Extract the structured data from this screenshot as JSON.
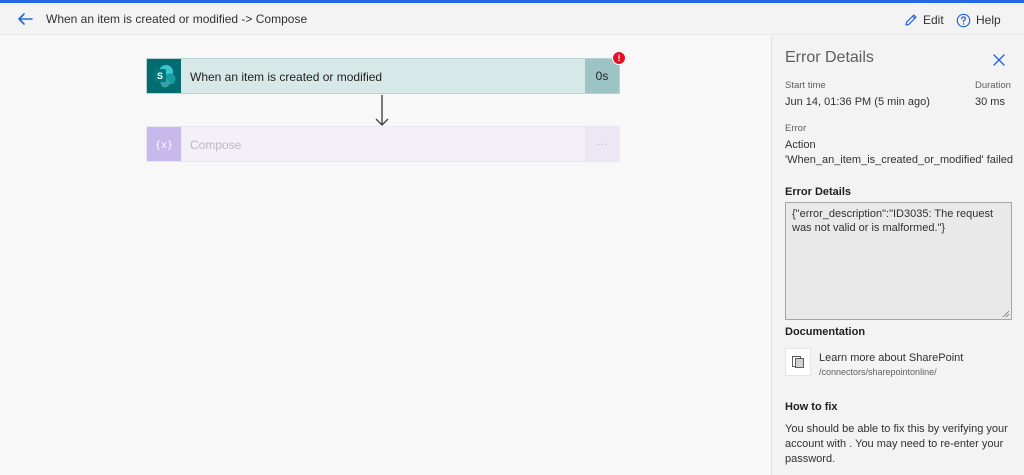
{
  "header": {
    "title": "When an item is created or modified -> Compose",
    "edit_label": "Edit",
    "help_label": "Help",
    "accent_color": "#2266e3"
  },
  "flow": {
    "trigger": {
      "label": "When an item is created or modified",
      "duration": "0s",
      "icon": "sharepoint-icon",
      "icon_letter": "S",
      "has_error": true,
      "error_badge": "!"
    },
    "compose": {
      "label": "Compose",
      "icon": "compose-braces-icon",
      "icon_text": "{x}",
      "status": "···"
    }
  },
  "panel": {
    "title": "Error Details",
    "start_time_label": "Start time",
    "start_time_value": "Jun 14, 01:36 PM (5 min ago)",
    "duration_label": "Duration",
    "duration_value": "30 ms",
    "error_label": "Error",
    "error_line1": "Action",
    "error_line2": "'When_an_item_is_created_or_modified' failed",
    "error_details_heading": "Error Details",
    "error_details_text": "{\"error_description\":\"ID3035: The request was not valid or is malformed.\"}",
    "documentation_heading": "Documentation",
    "doc_link_text": "Learn more about SharePoint",
    "doc_url": "/connectors/sharepointonline/",
    "how_to_fix_heading": "How to fix",
    "how_to_fix_text": "You should be able to fix this by verifying your account with . You may need to re-enter your password."
  }
}
